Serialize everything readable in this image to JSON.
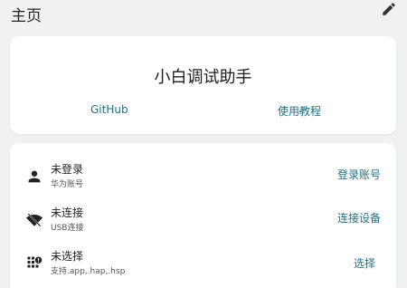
{
  "header": {
    "title": "主页",
    "edit_icon": "edit-icon"
  },
  "app": {
    "title": "小白调试助手",
    "links": {
      "github": "GitHub",
      "tutorial": "使用教程"
    }
  },
  "rows": [
    {
      "icon": "person-icon",
      "title": "未登录",
      "subtitle": "华为账号",
      "action": "登录账号"
    },
    {
      "icon": "wifi-off-icon",
      "title": "未连接",
      "subtitle": "USB连接",
      "action": "连接设备"
    },
    {
      "icon": "apps-alert-icon",
      "title": "未选择",
      "subtitle": "支持.app,.hap,.hsp",
      "action": "选择"
    }
  ],
  "colors": {
    "accent": "#1f6f86",
    "background": "#f0f1f3",
    "card": "#ffffff"
  }
}
